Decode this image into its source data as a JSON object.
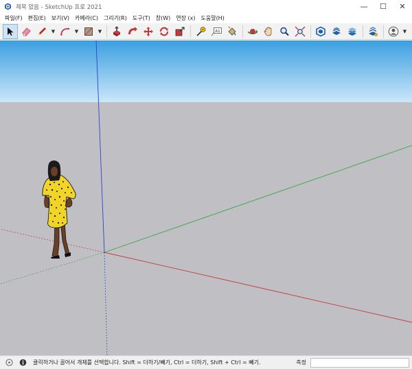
{
  "window": {
    "title": "제목 없음 - SketchUp 프로 2021",
    "minimize_glyph": "—",
    "maximize_glyph": "☐",
    "close_glyph": "✕"
  },
  "menu": [
    {
      "label": "파일(F)"
    },
    {
      "label": "편집(E)"
    },
    {
      "label": "보기(V)"
    },
    {
      "label": "카메라(C)"
    },
    {
      "label": "그리기(R)"
    },
    {
      "label": "도구(T)"
    },
    {
      "label": "창(W)"
    },
    {
      "label": "연장 (x)"
    },
    {
      "label": "도움말(H)"
    }
  ],
  "toolbar": {
    "text_tool_label": "A1"
  },
  "colors": {
    "sky_top": "#3a9fe0",
    "sky_bottom": "#cbe7f9",
    "ground": "#c0c0c4",
    "axis_red": "#c43a3a",
    "axis_green": "#3aa64a",
    "axis_blue": "#2d3fd0",
    "active_tool_bg": "#cfe3f5"
  },
  "status": {
    "hint": "클릭하거나 끌어서 개체를 선택합니다. Shift = 더하기/빼기, Ctrl = 더하기, Shift + Ctrl = 빼기.",
    "measure_label": "측정",
    "measure_value": ""
  }
}
